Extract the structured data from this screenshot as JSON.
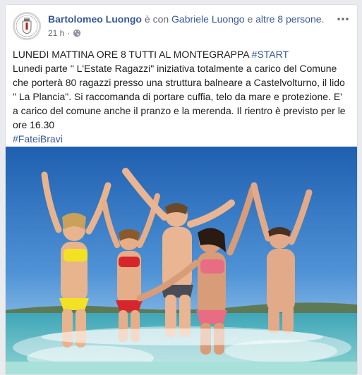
{
  "post": {
    "author": "Bartolomeo Luongo",
    "with_prefix": " è con ",
    "tagged_person": "Gabriele Luongo",
    "and_text": " e ",
    "others": "altre 8 persone",
    "period": ".",
    "timestamp": "21 h",
    "separator": "·",
    "audience_icon": "globe-icon",
    "more_icon": "more-options-icon",
    "text_heading": "LUNEDI MATTINA ORE 8 TUTTI AL MONTEGRAPPA ",
    "hashtag_start": "#START",
    "text_body": "Lunedi parte \" L'Estate Ragazzi\" iniziativa totalmente a carico del Comune che porterà 80 ragazzi presso una struttura balneare a Castelvolturno, il lido \" La Plancia\". Si raccomanda di portare cuffia, telo da mare e protezione. E' a carico del comune anche il pranzo e la merenda. Il rientro è previsto per le ore 16.30",
    "hashtag_end": "#FateiBravi"
  },
  "colors": {
    "link": "#385898",
    "text": "#1c1e21",
    "meta": "#616770",
    "page_bg": "#e9ebee"
  }
}
